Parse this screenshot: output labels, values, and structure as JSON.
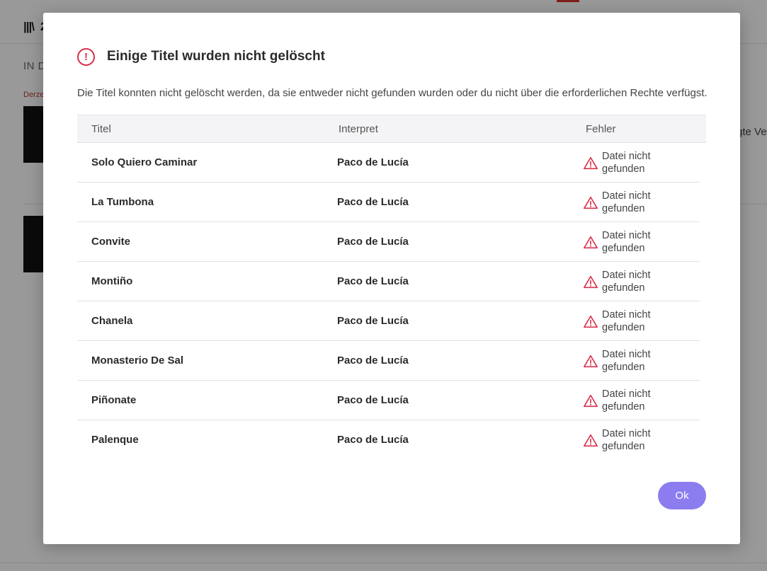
{
  "background": {
    "header_title": "2",
    "section_label": "IN D",
    "red_label": "Derze",
    "right_text": "gte Ve"
  },
  "dialog": {
    "icon": "alert-circle-icon",
    "title": "Einige Titel wurden nicht gelöscht",
    "description": "Die Titel konnten nicht gelöscht werden, da sie entweder nicht gefunden wurden oder du nicht über die erforderlichen Rechte verfügst.",
    "columns": [
      "Titel",
      "Interpret",
      "Fehler"
    ],
    "rows": [
      {
        "title": "Solo Quiero Caminar",
        "artist": "Paco de Lucía",
        "error": "Datei nicht gefunden"
      },
      {
        "title": "La Tumbona",
        "artist": "Paco de Lucía",
        "error": "Datei nicht gefunden"
      },
      {
        "title": "Convite",
        "artist": "Paco de Lucía",
        "error": "Datei nicht gefunden"
      },
      {
        "title": "Montiño",
        "artist": "Paco de Lucía",
        "error": "Datei nicht gefunden"
      },
      {
        "title": "Chanela",
        "artist": "Paco de Lucía",
        "error": "Datei nicht gefunden"
      },
      {
        "title": "Monasterio De Sal",
        "artist": "Paco de Lucía",
        "error": "Datei nicht gefunden"
      },
      {
        "title": "Piñonate",
        "artist": "Paco de Lucía",
        "error": "Datei nicht gefunden"
      },
      {
        "title": "Palenque",
        "artist": "Paco de Lucía",
        "error": "Datei nicht gefunden"
      }
    ],
    "error_icon": "warning-triangle-icon",
    "ok_label": "Ok"
  },
  "colors": {
    "alert": "#d9314b",
    "ok_button": "#8b7df0",
    "overlay": "rgba(0,0,0,0.4)"
  }
}
